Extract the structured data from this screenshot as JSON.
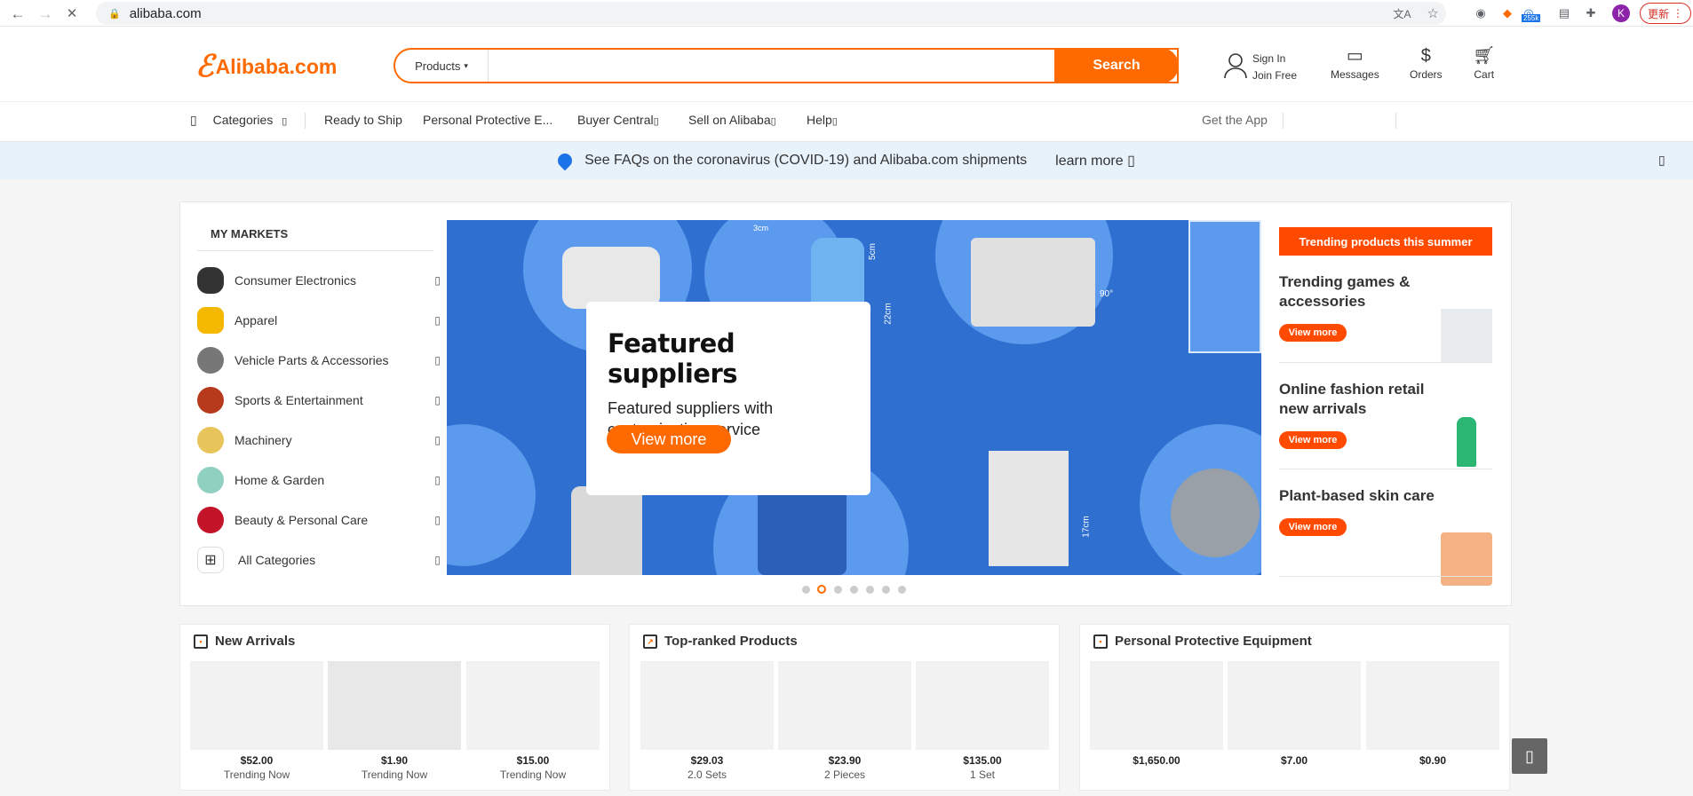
{
  "browser": {
    "url": "alibaba.com",
    "update_label": "更新",
    "profile_initial": "K",
    "ext_badge": "255k"
  },
  "header": {
    "logo_text": "Alibaba.com",
    "search_category": "Products",
    "search_placeholder": "",
    "search_button": "Search",
    "sign_in": "Sign In",
    "join_free": "Join Free",
    "messages": "Messages",
    "orders": "Orders",
    "cart": "Cart"
  },
  "catnav": {
    "categories": "Categories",
    "items": [
      "Ready to Ship",
      "Personal Protective E...",
      "Buyer Central",
      "Sell on Alibaba",
      "Help"
    ],
    "get_app": "Get the App"
  },
  "notice": {
    "text": "See FAQs on the coronavirus (COVID-19) and Alibaba.com shipments",
    "link": "learn more"
  },
  "markets": {
    "title": "MY MARKETS",
    "items": [
      "Consumer Electronics",
      "Apparel",
      "Vehicle Parts & Accessories",
      "Sports & Entertainment",
      "Machinery",
      "Home & Garden",
      "Beauty & Personal Care",
      "All Categories"
    ]
  },
  "banner": {
    "title": "Featured suppliers",
    "subtitle": "Featured suppliers with customization service",
    "button": "View more",
    "dims": [
      "3cm",
      "5cm",
      "22cm",
      "90°",
      "17cm"
    ],
    "slide_count": 7,
    "active_slide": 2
  },
  "trending": {
    "header": "Trending products this summer",
    "items": [
      {
        "title": "Trending games & accessories",
        "button": "View more"
      },
      {
        "title": "Online fashion retail new arrivals",
        "button": "View more"
      },
      {
        "title": "Plant-based skin care",
        "button": "View more"
      }
    ]
  },
  "sections": [
    {
      "title": "New Arrivals",
      "products": [
        {
          "price": "$52.00",
          "sub": "Trending Now"
        },
        {
          "price": "$1.90",
          "sub": "Trending Now"
        },
        {
          "price": "$15.00",
          "sub": "Trending Now"
        }
      ]
    },
    {
      "title": "Top-ranked Products",
      "products": [
        {
          "price": "$29.03",
          "sub": "2.0 Sets"
        },
        {
          "price": "$23.90",
          "sub": "2 Pieces"
        },
        {
          "price": "$135.00",
          "sub": "1 Set"
        }
      ]
    },
    {
      "title": "Personal Protective Equipment",
      "products": [
        {
          "price": "$1,650.00",
          "sub": ""
        },
        {
          "price": "$7.00",
          "sub": ""
        },
        {
          "price": "$0.90",
          "sub": ""
        }
      ]
    }
  ],
  "colors": {
    "brand": "#ff6a00",
    "banner_blue": "#2e6fd0",
    "notice_bg": "#e8f2fb"
  }
}
